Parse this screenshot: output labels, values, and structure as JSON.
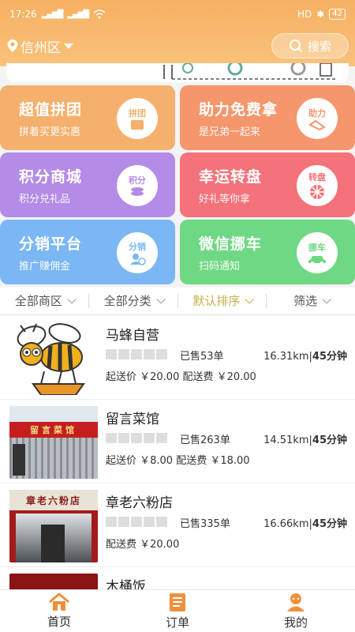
{
  "status": {
    "time": "17:26",
    "right": "HD",
    "battery": "42"
  },
  "header": {
    "location": "信州区",
    "search_label": "搜索"
  },
  "features": [
    {
      "title": "超值拼团",
      "subtitle": "拼着买更实惠",
      "icon_label": "拼团",
      "color": "#f4b06c"
    },
    {
      "title": "助力免费拿",
      "subtitle": "是兄弟一起来",
      "icon_label": "助力",
      "color": "#f6966d"
    },
    {
      "title": "积分商城",
      "subtitle": "积分兑礼品",
      "icon_label": "积分",
      "color": "#b48be6"
    },
    {
      "title": "幸运转盘",
      "subtitle": "好礼等你拿",
      "icon_label": "转盘",
      "color": "#f4727a"
    },
    {
      "title": "分销平台",
      "subtitle": "推广赚佣金",
      "icon_label": "分销",
      "color": "#7ab7f4"
    },
    {
      "title": "微信挪车",
      "subtitle": "扫码通知",
      "icon_label": "挪车",
      "color": "#6fd884"
    }
  ],
  "filters": [
    "全部商区",
    "全部分类",
    "默认排序",
    "筛选"
  ],
  "stores": [
    {
      "name": "马蜂自营",
      "sold": "已售53单",
      "distance": "16.31km",
      "time": "45分钟",
      "fees": "起送价 ￥20.00   配送费 ￥20.00"
    },
    {
      "name": "留言菜馆",
      "sold": "已售263单",
      "distance": "14.51km",
      "time": "45分钟",
      "fees": "起送价 ￥8.00   配送费 ￥18.00"
    },
    {
      "name": "章老六粉店",
      "sold": "已售335单",
      "distance": "16.66km",
      "time": "45分钟",
      "fees": "配送费 ￥20.00"
    },
    {
      "name": "木桶饭",
      "sold": "",
      "distance": "",
      "time": "",
      "fees": ""
    }
  ],
  "thumb_text": {
    "store2_sign": "留言菜馆",
    "store3_sign": "章老六粉店"
  },
  "nav": [
    {
      "label": "首页",
      "icon": "home-icon"
    },
    {
      "label": "订单",
      "icon": "order-list-icon"
    },
    {
      "label": "我的",
      "icon": "user-icon"
    }
  ],
  "colors": {
    "header": "#f6b062",
    "active_filter": "#c5b04a",
    "nav_icon": "#f0903c"
  }
}
